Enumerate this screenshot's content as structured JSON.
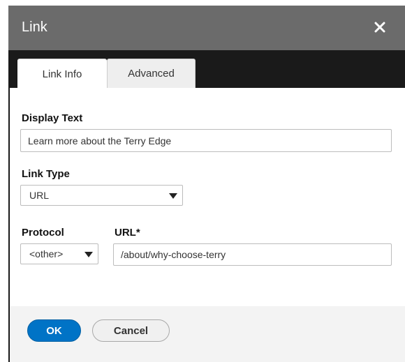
{
  "dialog": {
    "title": "Link",
    "close_icon": "close-icon"
  },
  "tabs": [
    {
      "label": "Link Info",
      "active": true
    },
    {
      "label": "Advanced",
      "active": false
    }
  ],
  "form": {
    "display_text": {
      "label": "Display Text",
      "value": "Learn more about the Terry Edge"
    },
    "link_type": {
      "label": "Link Type",
      "value": "URL"
    },
    "protocol": {
      "label": "Protocol",
      "value": "<other>"
    },
    "url": {
      "label": "URL*",
      "value": "/about/why-choose-terry"
    }
  },
  "footer": {
    "ok_label": "OK",
    "cancel_label": "Cancel"
  },
  "colors": {
    "titlebar": "#6b6b6b",
    "primary": "#0073c6",
    "dark_bg": "#1a1a1a",
    "footer_bg": "#f3f3f3"
  }
}
